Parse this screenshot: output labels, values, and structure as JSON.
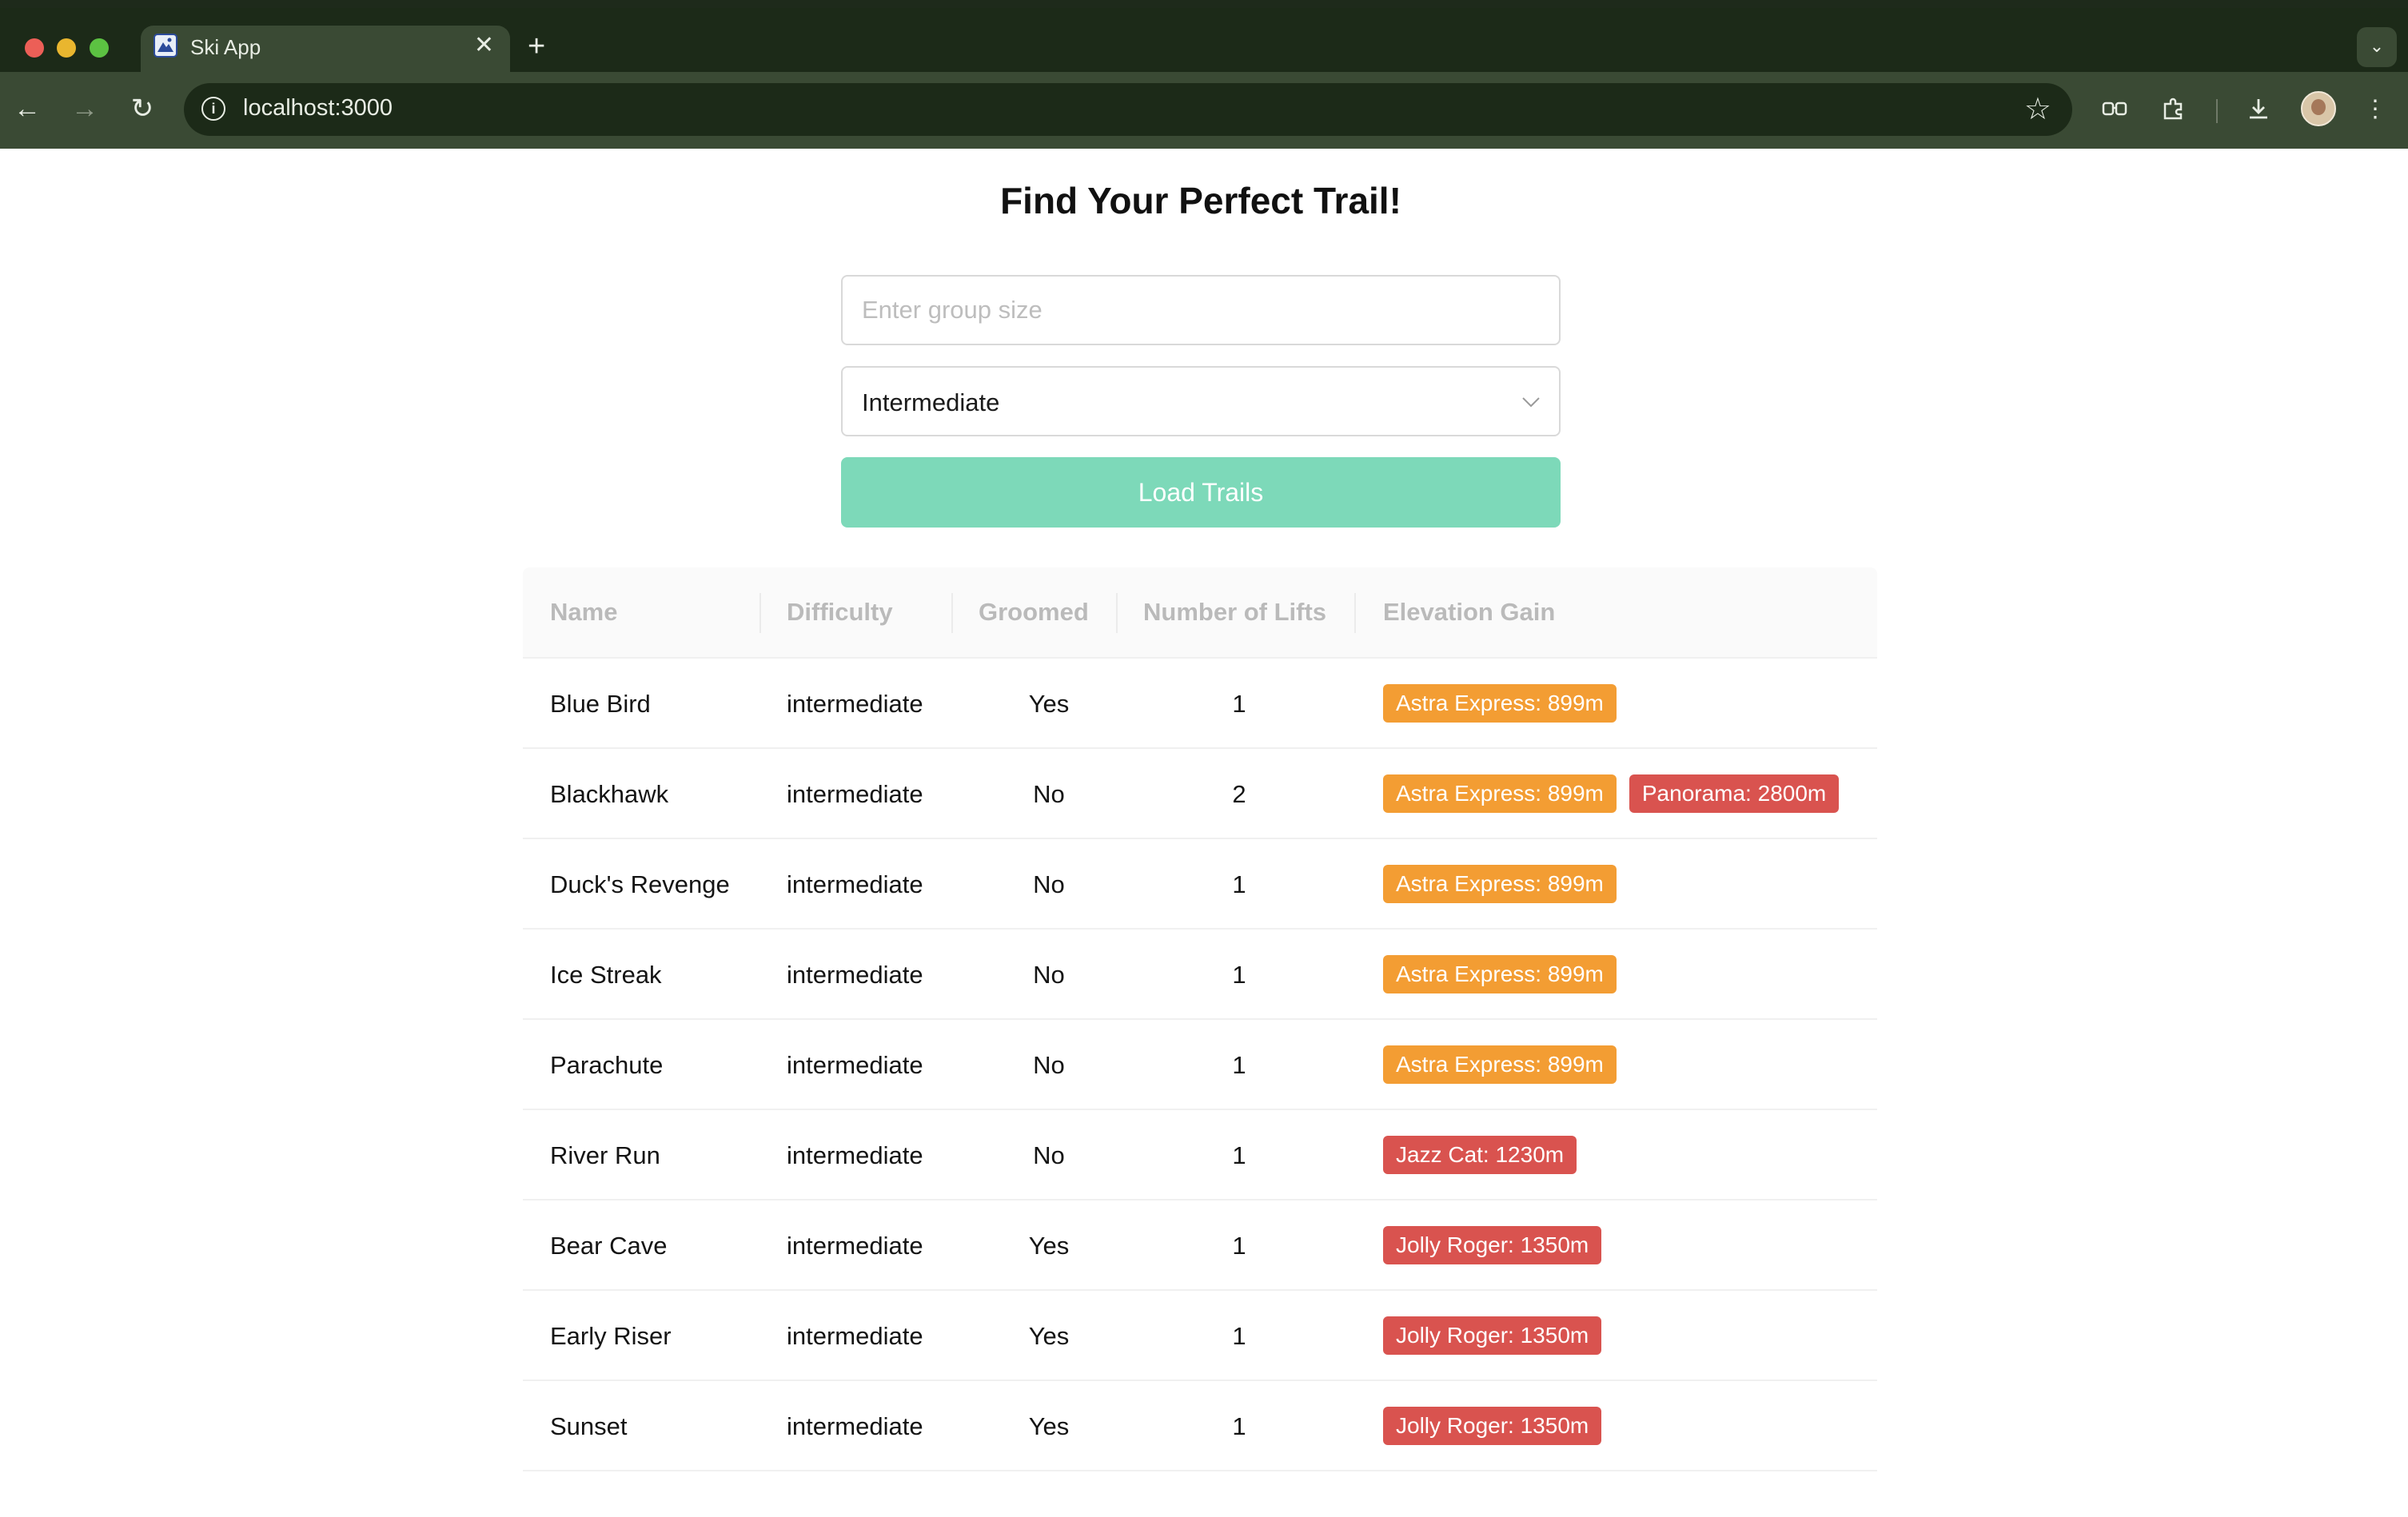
{
  "browser": {
    "tab_title": "Ski App",
    "url": "localhost:3000"
  },
  "page": {
    "title": "Find Your Perfect Trail!",
    "group_size_placeholder": "Enter group size",
    "difficulty_selected": "Intermediate",
    "load_button_label": "Load Trails"
  },
  "table": {
    "headers": [
      "Name",
      "Difficulty",
      "Groomed",
      "Number of Lifts",
      "Elevation Gain"
    ],
    "rows": [
      {
        "name": "Blue Bird",
        "difficulty": "intermediate",
        "groomed": "Yes",
        "lifts": "1",
        "lifts_tags": [
          {
            "label": "Astra Express: 899m",
            "color": "#f39d33"
          }
        ]
      },
      {
        "name": "Blackhawk",
        "difficulty": "intermediate",
        "groomed": "No",
        "lifts": "2",
        "lifts_tags": [
          {
            "label": "Astra Express: 899m",
            "color": "#f39d33"
          },
          {
            "label": "Panorama: 2800m",
            "color": "#d9534f"
          }
        ]
      },
      {
        "name": "Duck's Revenge",
        "difficulty": "intermediate",
        "groomed": "No",
        "lifts": "1",
        "lifts_tags": [
          {
            "label": "Astra Express: 899m",
            "color": "#f39d33"
          }
        ]
      },
      {
        "name": "Ice Streak",
        "difficulty": "intermediate",
        "groomed": "No",
        "lifts": "1",
        "lifts_tags": [
          {
            "label": "Astra Express: 899m",
            "color": "#f39d33"
          }
        ]
      },
      {
        "name": "Parachute",
        "difficulty": "intermediate",
        "groomed": "No",
        "lifts": "1",
        "lifts_tags": [
          {
            "label": "Astra Express: 899m",
            "color": "#f39d33"
          }
        ]
      },
      {
        "name": "River Run",
        "difficulty": "intermediate",
        "groomed": "No",
        "lifts": "1",
        "lifts_tags": [
          {
            "label": "Jazz Cat: 1230m",
            "color": "#d9534f"
          }
        ]
      },
      {
        "name": "Bear Cave",
        "difficulty": "intermediate",
        "groomed": "Yes",
        "lifts": "1",
        "lifts_tags": [
          {
            "label": "Jolly Roger: 1350m",
            "color": "#d9534f"
          }
        ]
      },
      {
        "name": "Early Riser",
        "difficulty": "intermediate",
        "groomed": "Yes",
        "lifts": "1",
        "lifts_tags": [
          {
            "label": "Jolly Roger: 1350m",
            "color": "#d9534f"
          }
        ]
      },
      {
        "name": "Sunset",
        "difficulty": "intermediate",
        "groomed": "Yes",
        "lifts": "1",
        "lifts_tags": [
          {
            "label": "Jolly Roger: 1350m",
            "color": "#d9534f"
          }
        ]
      }
    ]
  },
  "icons": {
    "back": "arrow-left-icon",
    "forward": "arrow-right-icon",
    "reload": "reload-icon",
    "info": "info-icon",
    "star": "star-icon",
    "extensions": "puzzle-icon",
    "download": "download-icon",
    "menu": "more-vertical-icon"
  },
  "colors": {
    "accent_button": "#7dd9b9",
    "tag_orange": "#f39d33",
    "tag_red": "#d9534f"
  }
}
